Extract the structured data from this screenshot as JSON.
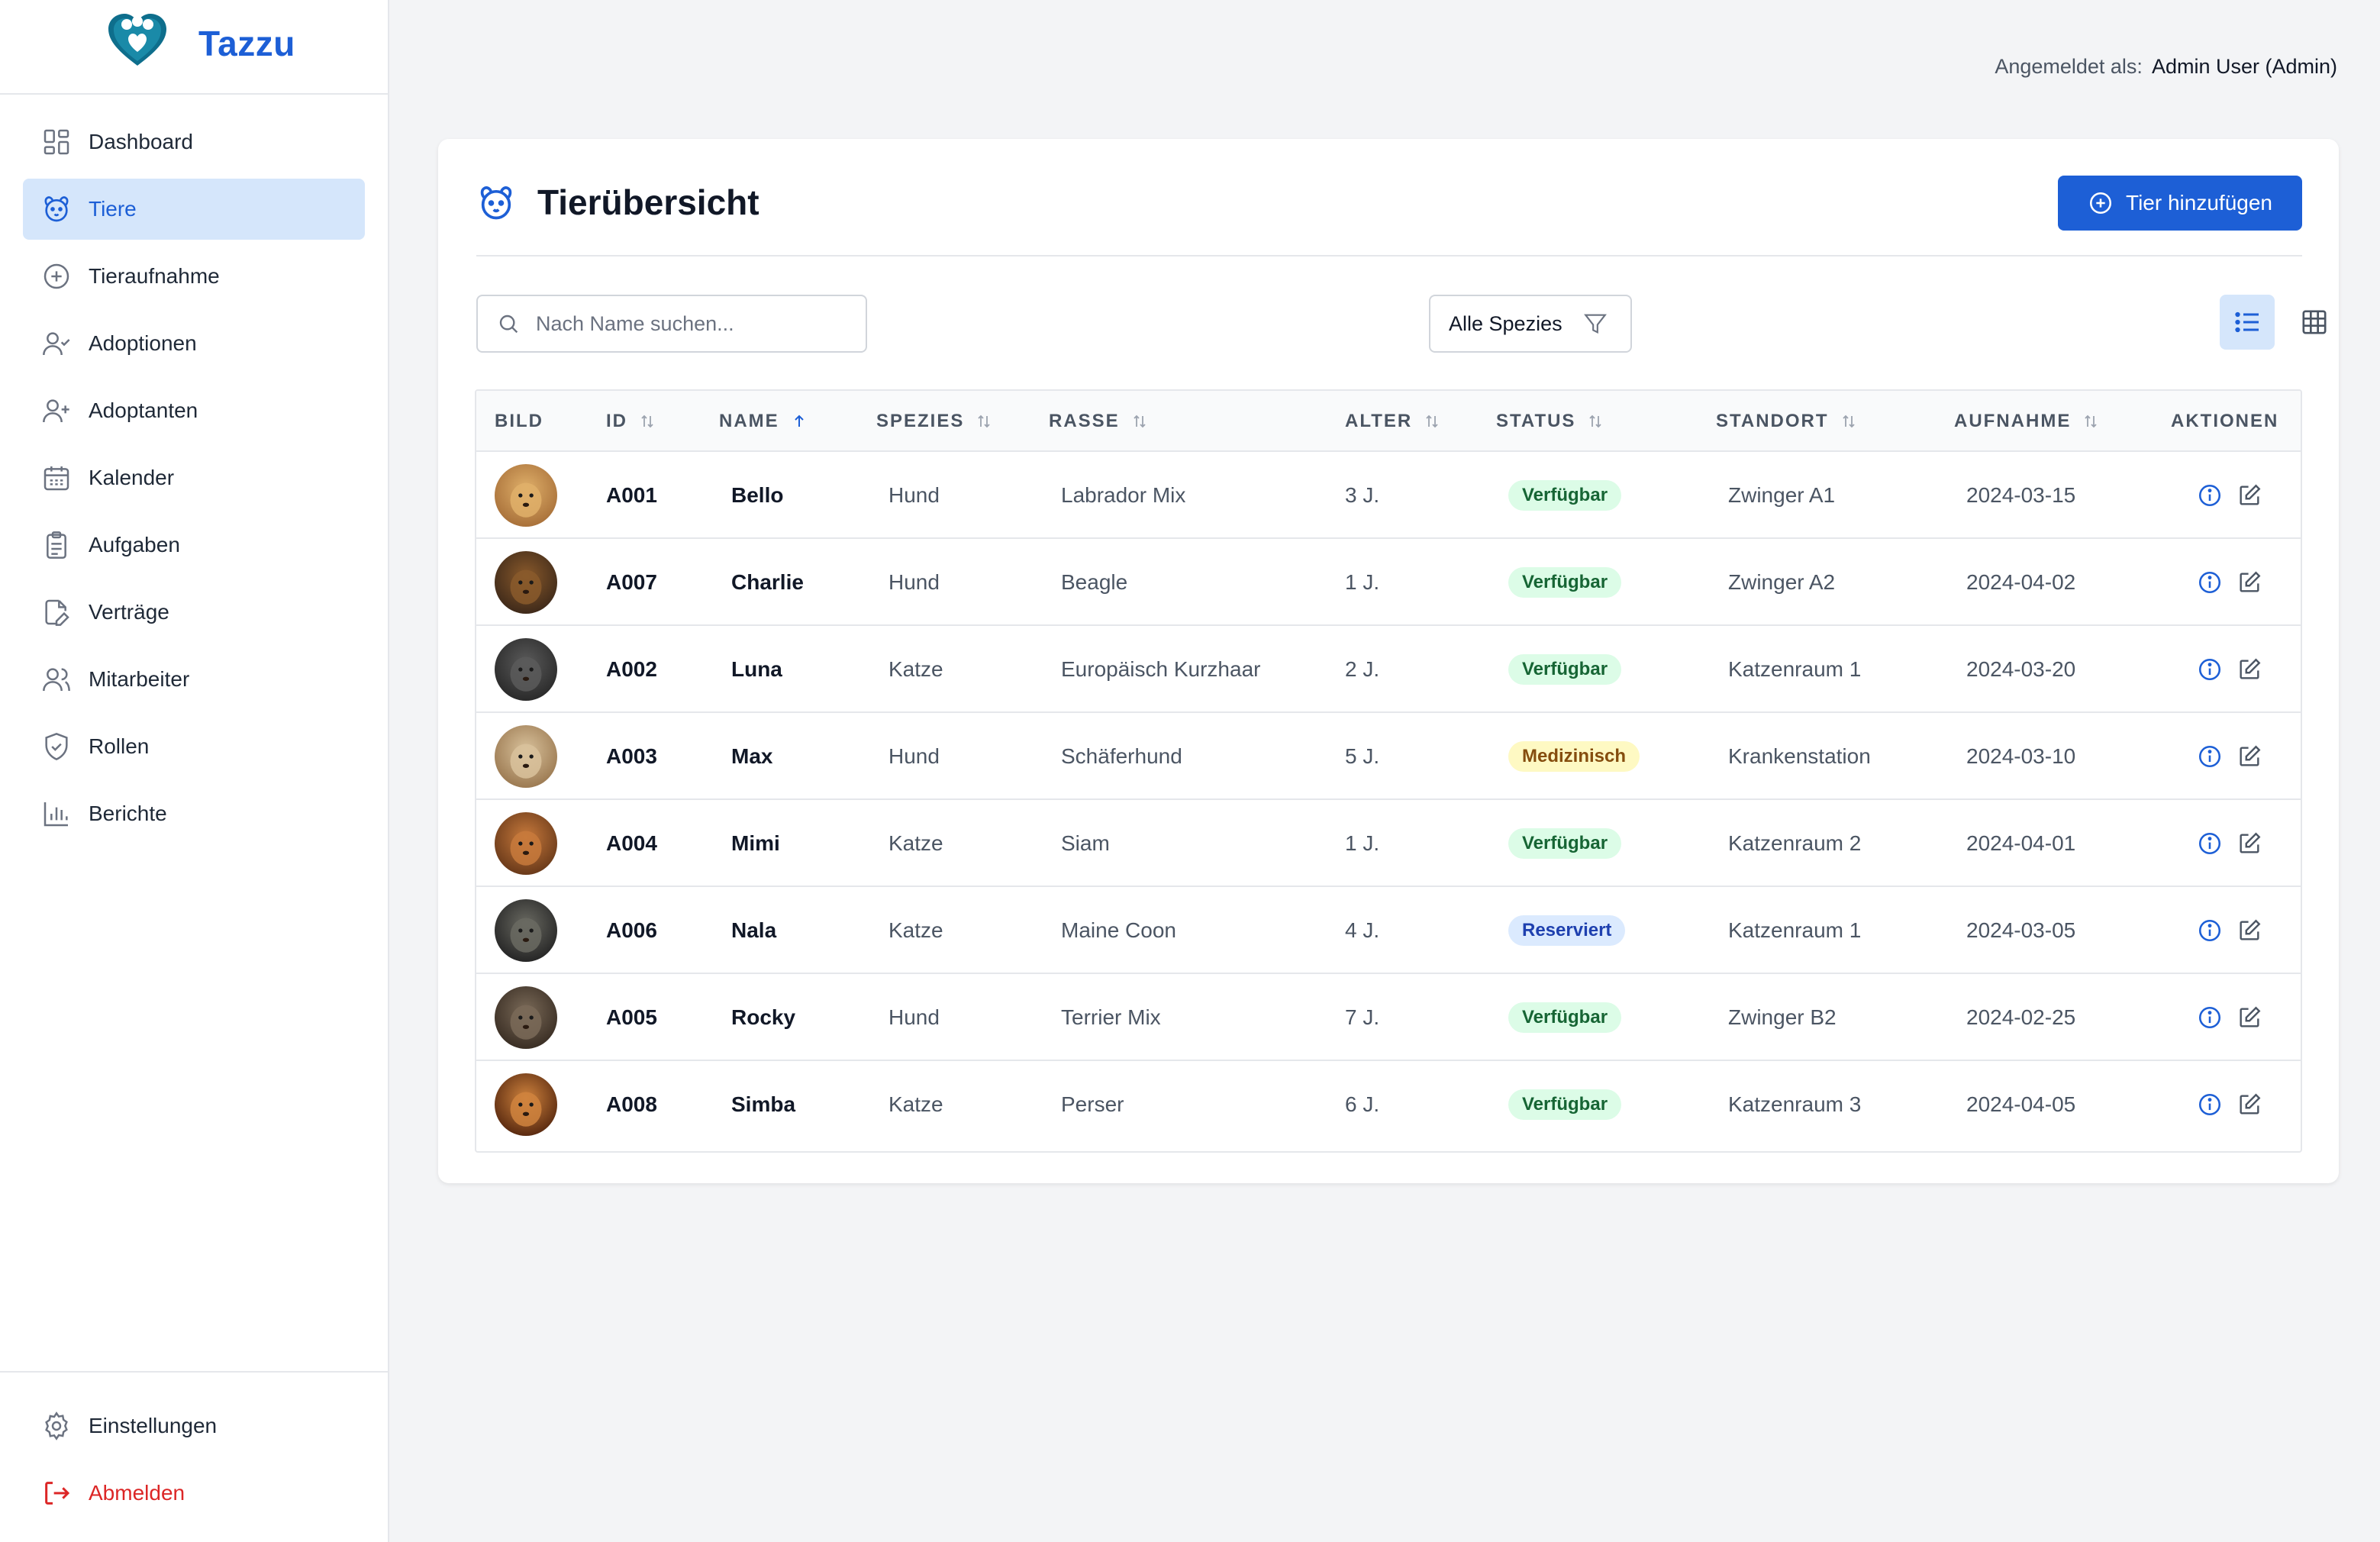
{
  "brand": {
    "name": "Tazzu"
  },
  "sidebar": {
    "items": [
      {
        "label": "Dashboard",
        "icon": "dashboard-icon"
      },
      {
        "label": "Tiere",
        "icon": "paw-icon",
        "active": true
      },
      {
        "label": "Tieraufnahme",
        "icon": "plus-circle-icon"
      },
      {
        "label": "Adoptionen",
        "icon": "user-check-icon"
      },
      {
        "label": "Adoptanten",
        "icon": "user-plus-icon"
      },
      {
        "label": "Kalender",
        "icon": "calendar-icon"
      },
      {
        "label": "Aufgaben",
        "icon": "clipboard-icon"
      },
      {
        "label": "Verträge",
        "icon": "file-edit-icon"
      },
      {
        "label": "Mitarbeiter",
        "icon": "users-icon"
      },
      {
        "label": "Rollen",
        "icon": "shield-check-icon"
      },
      {
        "label": "Berichte",
        "icon": "bar-chart-icon"
      }
    ],
    "bottom": [
      {
        "label": "Einstellungen",
        "icon": "gear-icon"
      },
      {
        "label": "Abmelden",
        "icon": "logout-icon"
      }
    ]
  },
  "header": {
    "logged_in_label": "Angemeldet als:",
    "user": "Admin User (Admin)"
  },
  "main": {
    "title": "Tierübersicht",
    "add_button": "Tier hinzufügen",
    "search": {
      "placeholder": "Nach Name suchen...",
      "value": ""
    },
    "species_filter": "Alle Spezies",
    "table": {
      "columns": [
        "BILD",
        "ID",
        "NAME",
        "SPEZIES",
        "RASSE",
        "ALTER",
        "STATUS",
        "STANDORT",
        "AUFNAHME",
        "AKTIONEN"
      ],
      "rows": [
        {
          "id": "A001",
          "name": "Bello",
          "species": "Hund",
          "breed": "Labrador Mix",
          "age": "3 J.",
          "status": "Verfügbar",
          "status_type": "available",
          "location": "Zwinger A1",
          "intake": "2024-03-15"
        },
        {
          "id": "A007",
          "name": "Charlie",
          "species": "Hund",
          "breed": "Beagle",
          "age": "1 J.",
          "status": "Verfügbar",
          "status_type": "available",
          "location": "Zwinger A2",
          "intake": "2024-04-02"
        },
        {
          "id": "A002",
          "name": "Luna",
          "species": "Katze",
          "breed": "Europäisch Kurzhaar",
          "age": "2 J.",
          "status": "Verfügbar",
          "status_type": "available",
          "location": "Katzenraum 1",
          "intake": "2024-03-20"
        },
        {
          "id": "A003",
          "name": "Max",
          "species": "Hund",
          "breed": "Schäferhund",
          "age": "5 J.",
          "status": "Medizinisch",
          "status_type": "medical",
          "location": "Krankenstation",
          "intake": "2024-03-10"
        },
        {
          "id": "A004",
          "name": "Mimi",
          "species": "Katze",
          "breed": "Siam",
          "age": "1 J.",
          "status": "Verfügbar",
          "status_type": "available",
          "location": "Katzenraum 2",
          "intake": "2024-04-01"
        },
        {
          "id": "A006",
          "name": "Nala",
          "species": "Katze",
          "breed": "Maine Coon",
          "age": "4 J.",
          "status": "Reserviert",
          "status_type": "reserved",
          "location": "Katzenraum 1",
          "intake": "2024-03-05"
        },
        {
          "id": "A005",
          "name": "Rocky",
          "species": "Hund",
          "breed": "Terrier Mix",
          "age": "7 J.",
          "status": "Verfügbar",
          "status_type": "available",
          "location": "Zwinger B2",
          "intake": "2024-02-25"
        },
        {
          "id": "A008",
          "name": "Simba",
          "species": "Katze",
          "breed": "Perser",
          "age": "6 J.",
          "status": "Verfügbar",
          "status_type": "available",
          "location": "Katzenraum 3",
          "intake": "2024-04-05"
        }
      ]
    }
  },
  "colors": {
    "accent": "#1d5fd6",
    "active_bg": "#d5e6fb",
    "logout": "#dc2626",
    "available": "#166534",
    "medical": "#854d0e",
    "reserved": "#1e40af"
  }
}
